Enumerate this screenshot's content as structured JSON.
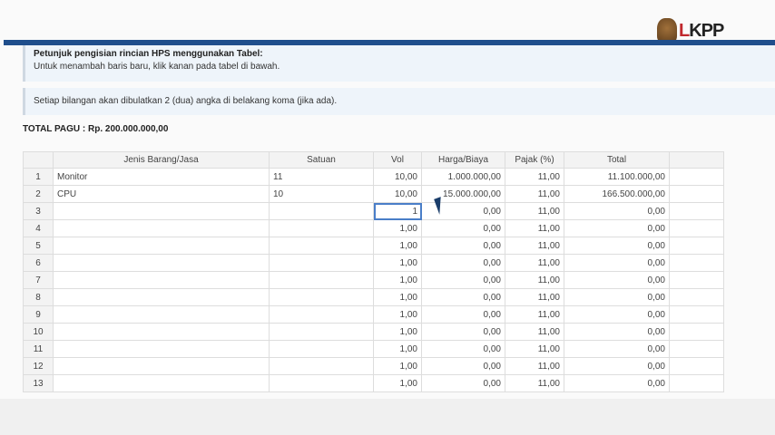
{
  "logo": {
    "text": "LKPP"
  },
  "info": {
    "title": "Petunjuk pengisian rincian HPS menggunakan Tabel:",
    "line": "Untuk menambah baris baru, klik kanan pada tabel di bawah.",
    "rounding": "Setiap bilangan akan dibulatkan 2 (dua) angka di belakang koma (jika ada)."
  },
  "total_pagu": "TOTAL PAGU : Rp. 200.000.000,00",
  "table": {
    "headers": [
      "",
      "Jenis Barang/Jasa",
      "Satuan",
      "Vol",
      "Harga/Biaya",
      "Pajak (%)",
      "Total",
      ""
    ],
    "rows": [
      [
        "1",
        "Monitor",
        "11",
        "10,00",
        "1.000.000,00",
        "11,00",
        "11.100.000,00"
      ],
      [
        "2",
        "CPU",
        "10",
        "10,00",
        "15.000.000,00",
        "11,00",
        "166.500.000,00"
      ],
      [
        "3",
        "",
        "",
        "1",
        "0,00",
        "11,00",
        "0,00"
      ],
      [
        "4",
        "",
        "",
        "1,00",
        "0,00",
        "11,00",
        "0,00"
      ],
      [
        "5",
        "",
        "",
        "1,00",
        "0,00",
        "11,00",
        "0,00"
      ],
      [
        "6",
        "",
        "",
        "1,00",
        "0,00",
        "11,00",
        "0,00"
      ],
      [
        "7",
        "",
        "",
        "1,00",
        "0,00",
        "11,00",
        "0,00"
      ],
      [
        "8",
        "",
        "",
        "1,00",
        "0,00",
        "11,00",
        "0,00"
      ],
      [
        "9",
        "",
        "",
        "1,00",
        "0,00",
        "11,00",
        "0,00"
      ],
      [
        "10",
        "",
        "",
        "1,00",
        "0,00",
        "11,00",
        "0,00"
      ],
      [
        "11",
        "",
        "",
        "1,00",
        "0,00",
        "11,00",
        "0,00"
      ],
      [
        "12",
        "",
        "",
        "1,00",
        "0,00",
        "11,00",
        "0,00"
      ],
      [
        "13",
        "",
        "",
        "1,00",
        "0,00",
        "11,00",
        "0,00"
      ]
    ]
  }
}
